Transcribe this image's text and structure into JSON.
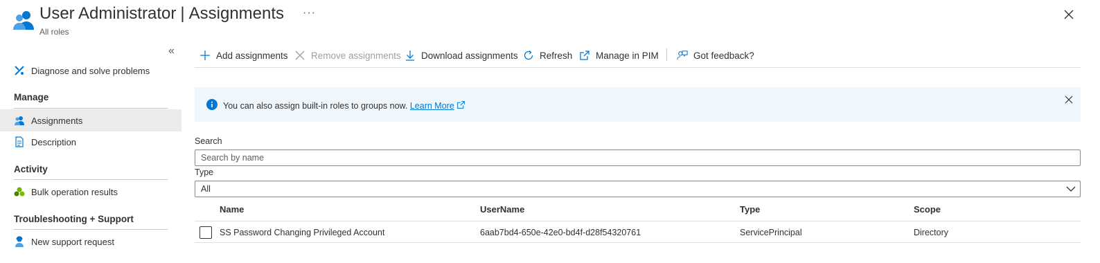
{
  "header": {
    "title_main": "User Administrator",
    "title_separator": "|",
    "title_page": "Assignments",
    "subtitle": "All roles",
    "more_label": "···",
    "icon": "users-icon",
    "close_icon": "close-icon"
  },
  "sidebar": {
    "collapse_label": "«",
    "items": [
      {
        "label": "Diagnose and solve problems",
        "icon": "wrench-icon"
      }
    ],
    "sections": [
      {
        "title": "Manage",
        "items": [
          {
            "label": "Assignments",
            "icon": "users-icon",
            "active": true
          },
          {
            "label": "Description",
            "icon": "document-icon"
          }
        ]
      },
      {
        "title": "Activity",
        "items": [
          {
            "label": "Bulk operation results",
            "icon": "group-icon"
          }
        ]
      },
      {
        "title": "Troubleshooting + Support",
        "items": [
          {
            "label": "New support request",
            "icon": "support-icon"
          }
        ]
      }
    ]
  },
  "toolbar": {
    "add": "Add assignments",
    "remove": "Remove assignments",
    "download": "Download assignments",
    "refresh": "Refresh",
    "pim": "Manage in PIM",
    "feedback": "Got feedback?"
  },
  "info_bar": {
    "text": "You can also assign built-in roles to groups now.",
    "link": "Learn More"
  },
  "search": {
    "label": "Search",
    "placeholder": "Search by name",
    "value": ""
  },
  "type_filter": {
    "label": "Type",
    "selected": "All"
  },
  "table": {
    "columns": [
      "Name",
      "UserName",
      "Type",
      "Scope"
    ],
    "rows": [
      {
        "name": "SS Password Changing Privileged Account",
        "username": "6aab7bd4-650e-42e0-bd4f-d28f54320761",
        "type": "ServicePrincipal",
        "scope": "Directory",
        "checked": false
      }
    ]
  },
  "colors": {
    "accent": "#0078d4",
    "info_bg": "#eff6fc",
    "active_nav": "#edebe9"
  }
}
